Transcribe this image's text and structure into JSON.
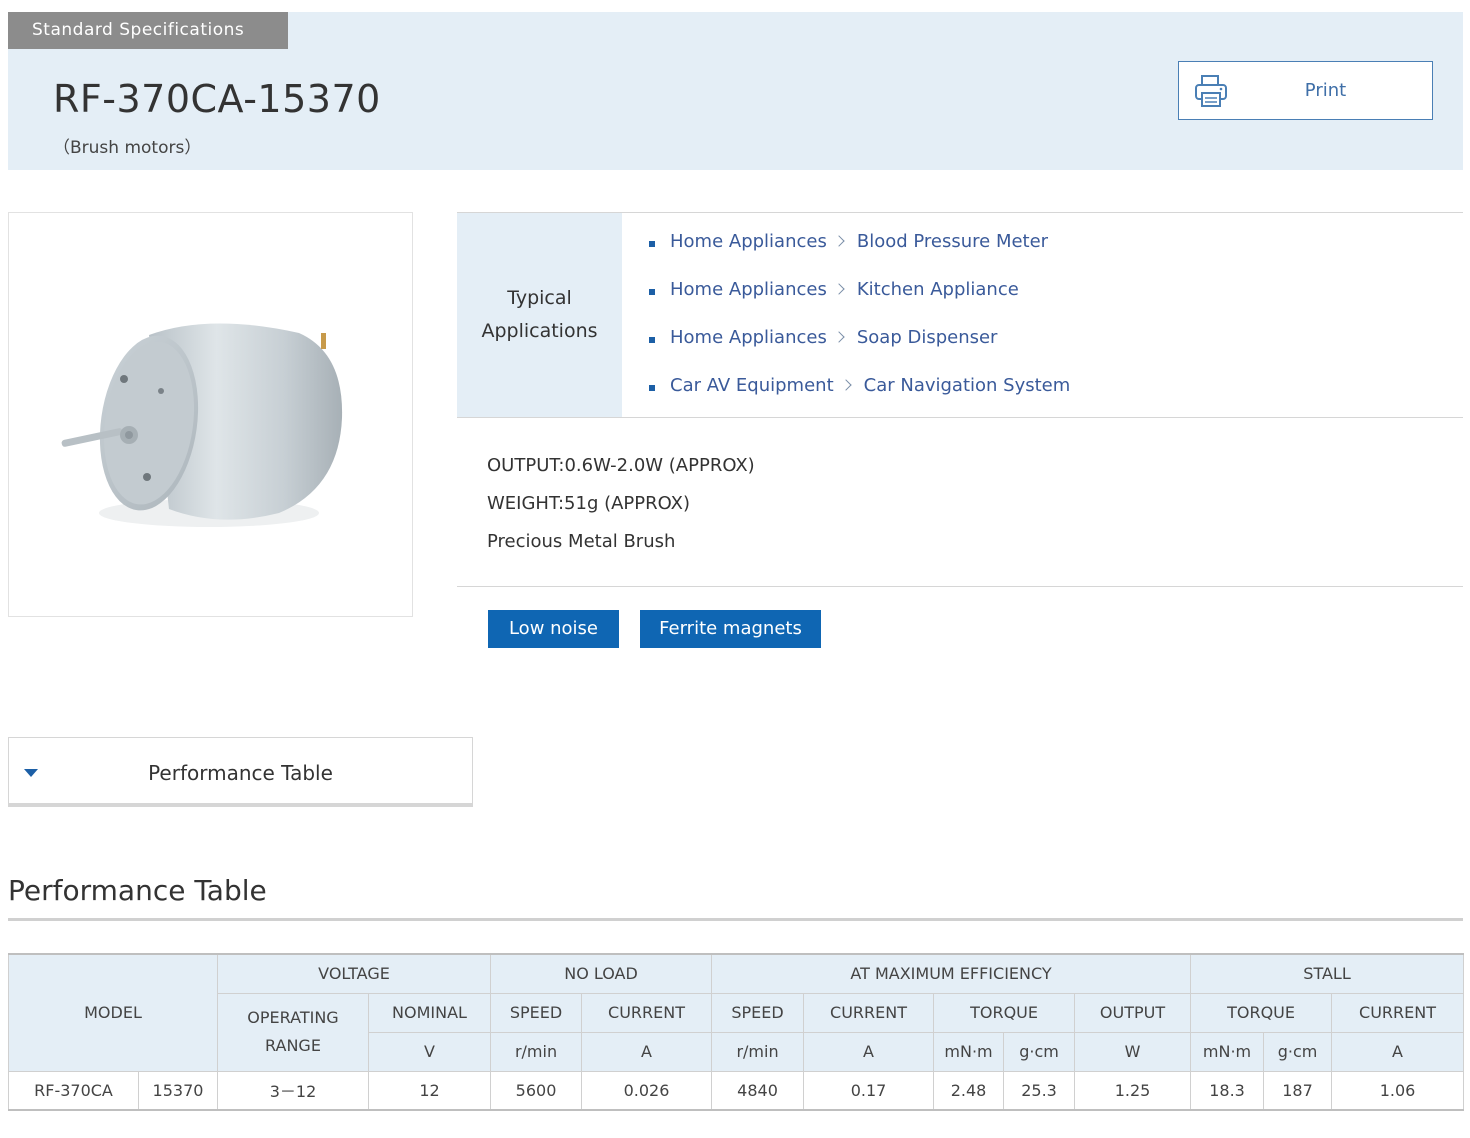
{
  "header": {
    "tag": "Standard Specifications",
    "model": "RF-370CA-15370",
    "category": "（Brush motors）",
    "print_label": "Print"
  },
  "applications": {
    "heading": "Typical Applications",
    "items": [
      {
        "category": "Home Appliances",
        "item": "Blood Pressure Meter"
      },
      {
        "category": "Home Appliances",
        "item": "Kitchen Appliance"
      },
      {
        "category": "Home Appliances",
        "item": "Soap Dispenser"
      },
      {
        "category": "Car AV Equipment",
        "item": "Car Navigation System"
      }
    ]
  },
  "specs": [
    "OUTPUT:0.6W-2.0W (APPROX)",
    "WEIGHT:51g (APPROX)",
    "Precious Metal Brush"
  ],
  "features": [
    "Low noise",
    "Ferrite magnets"
  ],
  "accordion_label": "Performance Table",
  "section_title": "Performance Table",
  "table": {
    "model": "MODEL",
    "voltage": "VOLTAGE",
    "no_load": "NO LOAD",
    "max_eff": "AT MAXIMUM EFFICIENCY",
    "stall": "STALL",
    "operating_range": "OPERATING RANGE",
    "nominal": "NOMINAL",
    "speed": "SPEED",
    "current": "CURRENT",
    "torque": "TORQUE",
    "output": "OUTPUT",
    "u_v": "V",
    "u_rmin": "r/min",
    "u_a": "A",
    "u_mnm": "mN·m",
    "u_gcm": "g·cm",
    "u_w": "W",
    "row": {
      "model": "RF-370CA",
      "variant": "15370",
      "operating_range": "3－12",
      "nominal": "12",
      "nl_speed": "5600",
      "nl_current": "0.026",
      "me_speed": "4840",
      "me_current": "0.17",
      "me_torque_mnm": "2.48",
      "me_torque_gcm": "25.3",
      "me_output": "1.25",
      "st_torque_mnm": "18.3",
      "st_torque_gcm": "187",
      "st_current": "1.06"
    }
  },
  "colors": {
    "accent": "#0f66b3",
    "header_bg": "#e4eef6",
    "tag_bg": "#8c8c8c",
    "link": "#3a5a9a"
  },
  "icons": {
    "print": "printer-icon",
    "accordion": "triangle-down-icon",
    "separator": "chevron-right-icon"
  }
}
